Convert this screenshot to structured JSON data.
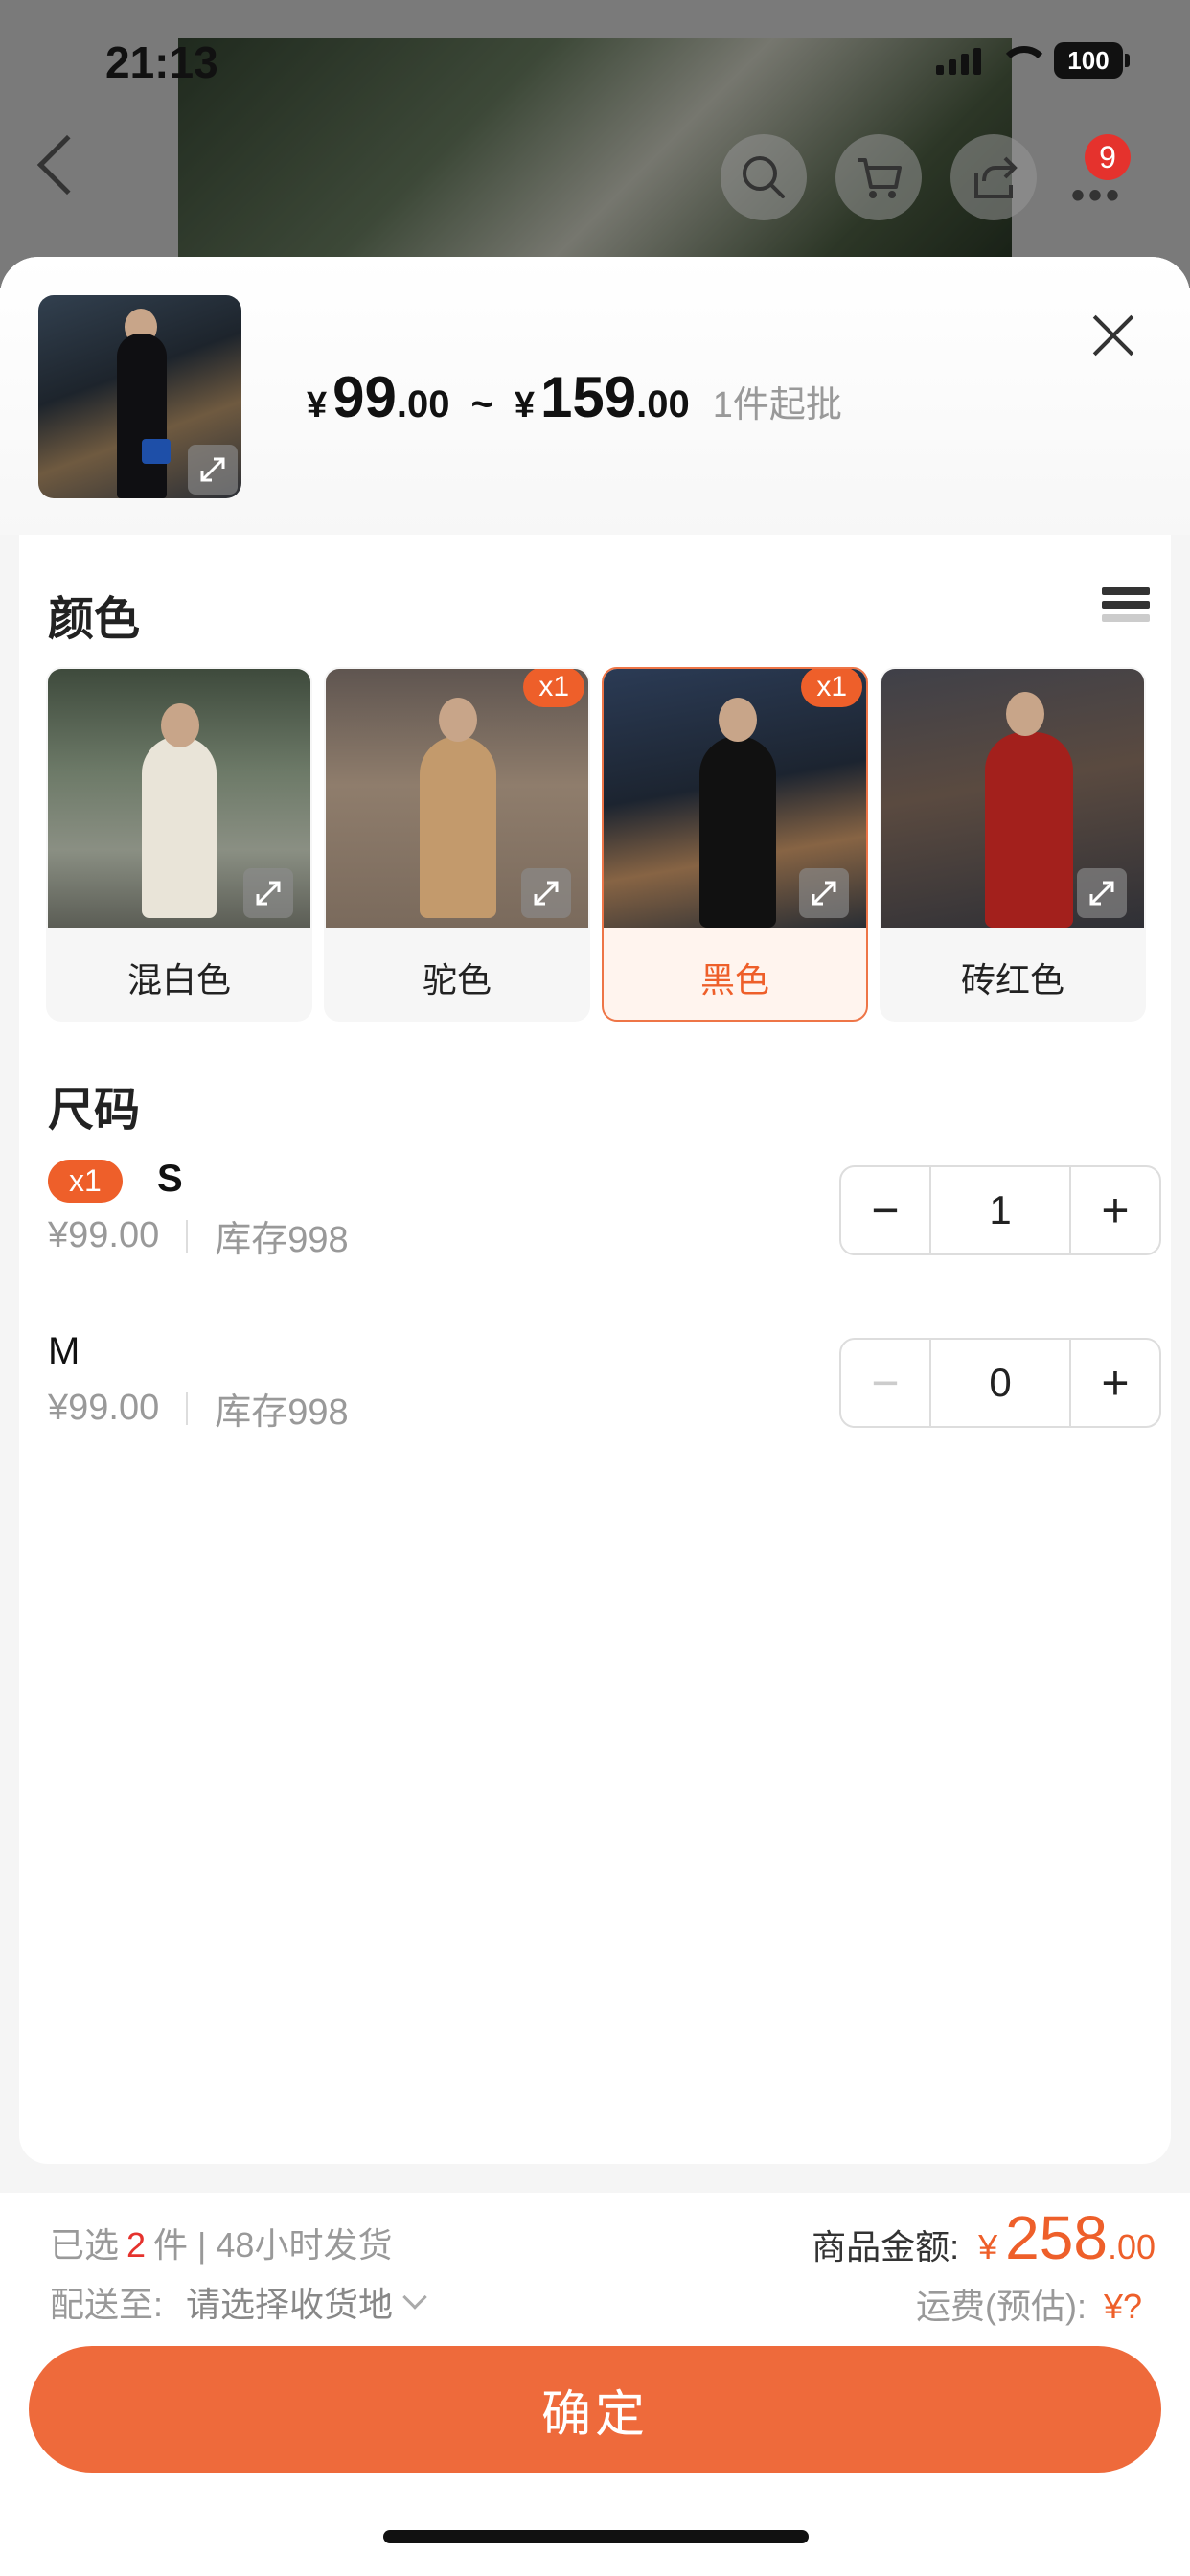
{
  "status_bar": {
    "time": "21:13",
    "battery": "100"
  },
  "nav": {
    "cart_count": "9"
  },
  "header": {
    "price_min_currency": "¥",
    "price_min_int": "99",
    "price_min_dec": ".00",
    "range_sep": "~",
    "price_max_currency": "¥",
    "price_max_int": "159",
    "price_max_dec": ".00",
    "moq": "1件起批"
  },
  "color_section": {
    "title": "颜色",
    "options": [
      {
        "label": "混白色",
        "qty": ""
      },
      {
        "label": "驼色",
        "qty": "x1"
      },
      {
        "label": "黑色",
        "qty": "x1",
        "selected": true
      },
      {
        "label": "砖红色",
        "qty": ""
      }
    ]
  },
  "size_section": {
    "title": "尺码",
    "rows": [
      {
        "badge": "x1",
        "name": "S",
        "price": "¥99.00",
        "stock": "库存998",
        "qty": "1"
      },
      {
        "badge": "",
        "name": "M",
        "price": "¥99.00",
        "stock": "库存998",
        "qty": "0"
      }
    ]
  },
  "footer": {
    "selected_prefix": "已选",
    "selected_count": "2",
    "selected_suffix": "件 | 48小时发货",
    "ship_label": "配送至:",
    "ship_value": "请选择收货地",
    "total_label": "商品金额:",
    "total_currency": "¥",
    "total_int": "258",
    "total_dec": ".00",
    "freight_label": "运费(预估):",
    "freight_value": "¥?",
    "confirm_label": "确定"
  },
  "colors": {
    "accent": "#ee5f2a",
    "button": "#ee6a3b",
    "badge_red": "#e5322d"
  }
}
